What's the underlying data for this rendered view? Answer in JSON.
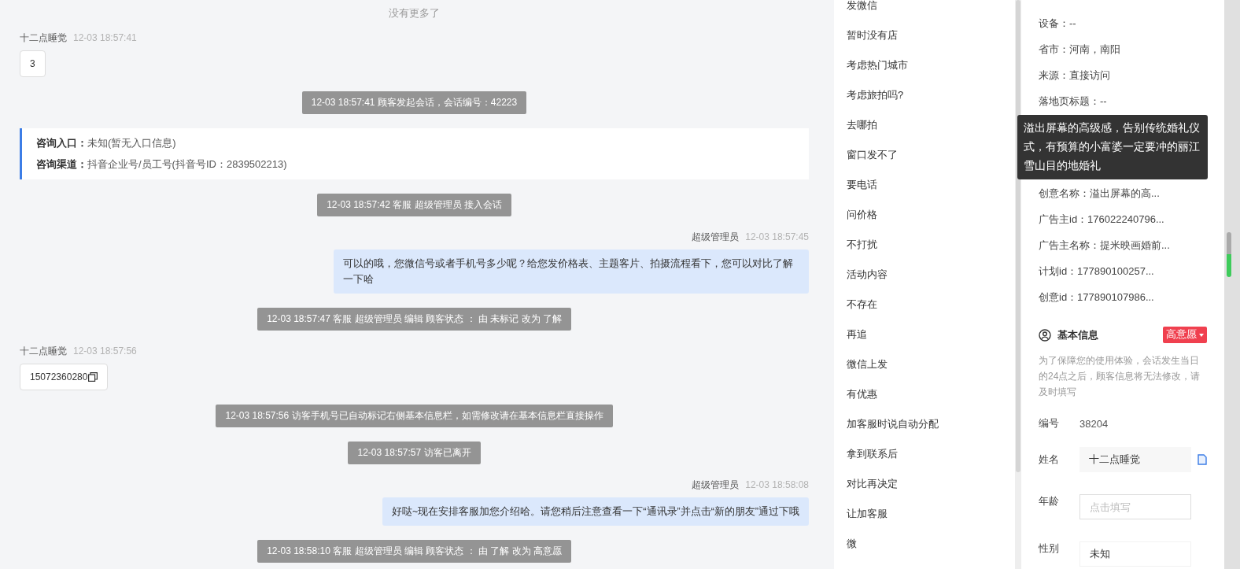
{
  "chat": {
    "top_notice": "没有更多了",
    "messages": [
      {
        "kind": "visitor",
        "sender": "十二点睡觉",
        "time": "12-03 18:57:41",
        "text": "3",
        "copyable": false
      },
      {
        "kind": "system",
        "text": "12-03 18:57:41 顾客发起会话，会话编号：42223"
      },
      {
        "kind": "info",
        "lines": [
          {
            "label": "咨询入口：",
            "value": "未知(暂无入口信息)"
          },
          {
            "label": "咨询渠道：",
            "value": "抖音企业号/员工号(抖音号ID：2839502213)"
          }
        ]
      },
      {
        "kind": "system",
        "text": "12-03 18:57:42 客服 超级管理员 接入会话"
      },
      {
        "kind": "agent",
        "sender": "超级管理员",
        "time": "12-03 18:57:45",
        "text": "可以的哦，您微信号或者手机号多少呢？给您发价格表、主题客片、拍摄流程看下，您可以对比了解一下哈"
      },
      {
        "kind": "system",
        "text": "12-03 18:57:47 客服 超级管理员 编辑 顾客状态 ： 由 未标记 改为 了解"
      },
      {
        "kind": "visitor",
        "sender": "十二点睡觉",
        "time": "12-03 18:57:56",
        "text": "15072360280",
        "copyable": true
      },
      {
        "kind": "system",
        "text": "12-03 18:57:56 访客手机号已自动标记右侧基本信息栏，如需修改请在基本信息栏直接操作"
      },
      {
        "kind": "system",
        "text": "12-03 18:57:57 访客已离开"
      },
      {
        "kind": "agent",
        "sender": "超级管理员",
        "time": "12-03 18:58:08",
        "text": "好哒~现在安排客服加您介绍哈。请您稍后注意查看一下“通讯录”并点击“新的朋友”通过下哦"
      },
      {
        "kind": "system",
        "text": "12-03 18:58:10 客服 超级管理员 编辑 顾客状态 ： 由 了解 改为 高意愿"
      }
    ]
  },
  "quick_replies": [
    "发微信",
    "暂时没有店",
    "考虑热门城市",
    "考虑旅拍吗?",
    "去哪拍",
    "窗口发不了",
    "要电话",
    "问价格",
    "不打扰",
    "活动内容",
    "不存在",
    "再追",
    "微信上发",
    "有优惠",
    "加客服时说自动分配",
    "拿到联系后",
    "对比再决定",
    "让加客服",
    "微"
  ],
  "visitor_info": {
    "fields_before": [
      "设备：--",
      "省市：河南，南阳",
      "来源：直接访问",
      "落地页标题：--"
    ],
    "tooltip": "溢出屏幕的高级感，告别传统婚礼仪式，有预算的小富婆一定要冲的丽江雪山目的地婚礼",
    "fields_after": [
      "创意名称：溢出屏幕的高...",
      "广告主id：176022240796...",
      "广告主名称：提米映画婚前...",
      "计划id：177890100257...",
      "创意id：177890107986..."
    ]
  },
  "basic_info": {
    "title": "基本信息",
    "status_tag": "高意愿",
    "notice": "为了保障您的使用体验，会话发生当日的24点之后，顾客信息将无法修改，请及时填写",
    "id_label": "编号",
    "id_value": "38204",
    "fields": [
      {
        "label": "姓名",
        "kind": "readonly",
        "value": "十二点睡觉"
      },
      {
        "label": "年龄",
        "kind": "input",
        "placeholder": "点击填写"
      },
      {
        "label": "性别",
        "kind": "select",
        "value": "未知"
      }
    ]
  }
}
